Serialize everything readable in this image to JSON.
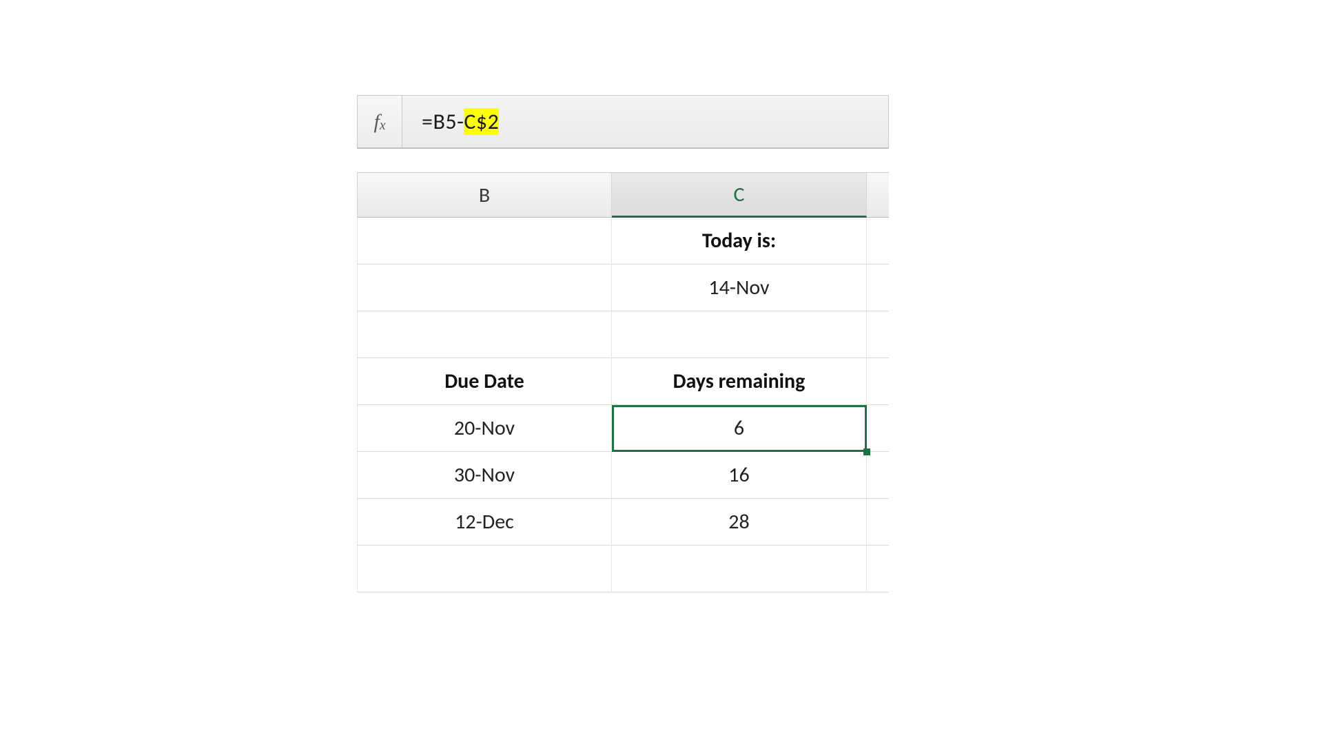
{
  "formula_bar": {
    "fx_label_main": "f",
    "fx_label_sub": "x",
    "prefix": "=B5-",
    "highlighted": "C$2"
  },
  "columns": {
    "B": "B",
    "C": "C"
  },
  "rows": {
    "r1": {
      "B": "",
      "C": "Today is:"
    },
    "r2": {
      "B": "",
      "C": "14-Nov"
    },
    "r3": {
      "B": "",
      "C": ""
    },
    "r4": {
      "B": "Due Date",
      "C": "Days remaining"
    },
    "r5": {
      "B": "20-Nov",
      "C": "6"
    },
    "r6": {
      "B": "30-Nov",
      "C": "16"
    },
    "r7": {
      "B": "12-Dec",
      "C": "28"
    },
    "r8": {
      "B": "",
      "C": ""
    }
  },
  "selection": {
    "col": "C",
    "row_index": 5
  }
}
